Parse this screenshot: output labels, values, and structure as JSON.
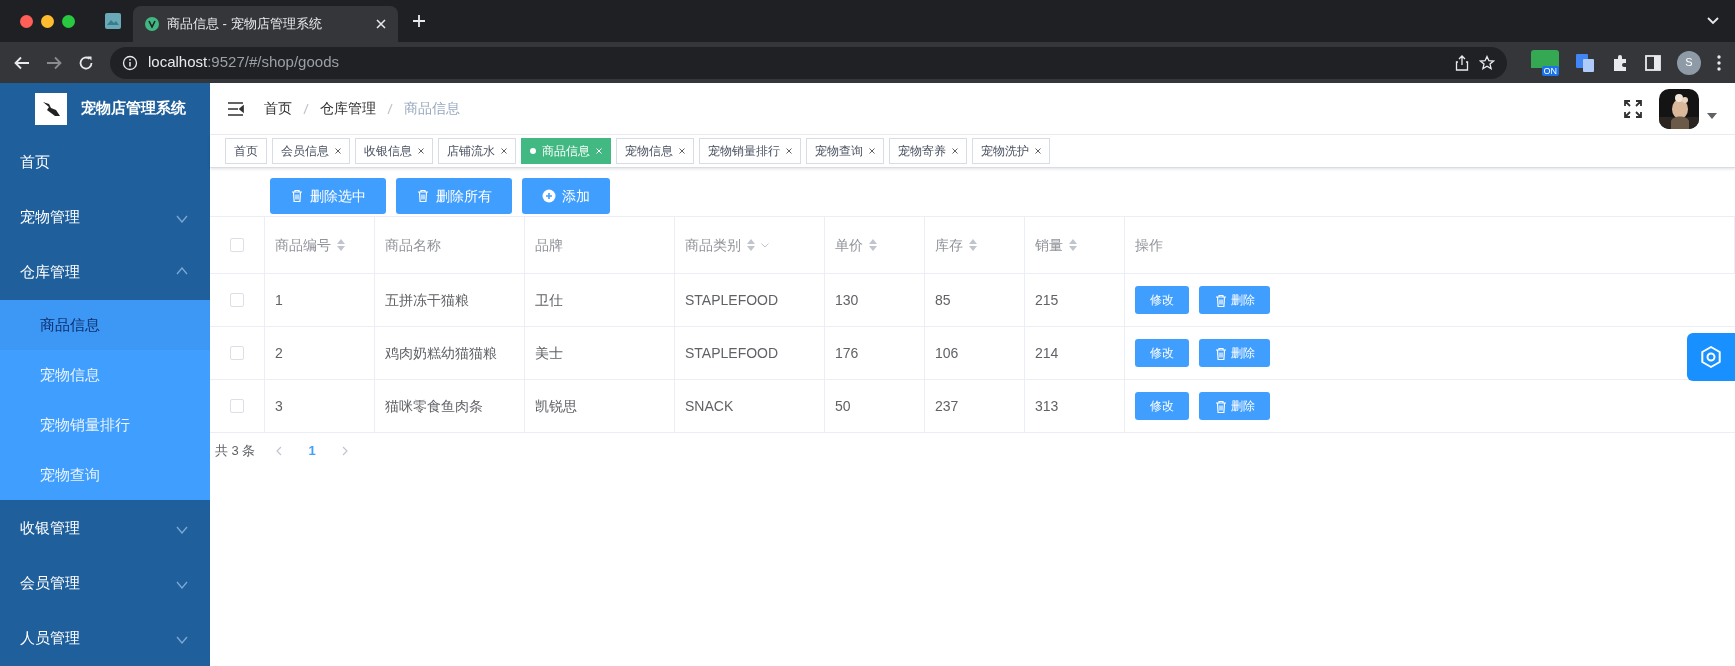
{
  "browser": {
    "tab_title": "商品信息 - 宠物店管理系统",
    "url_host": "localhost",
    "url_path": ":9527/#/shop/goods",
    "extension_badge": "ON",
    "profile_initial": "S"
  },
  "sidebar": {
    "title": "宠物店管理系统",
    "items": [
      {
        "label": "首页",
        "kind": "link",
        "selected": false
      },
      {
        "label": "宠物管理",
        "kind": "group",
        "expanded": false,
        "selected": false
      },
      {
        "label": "仓库管理",
        "kind": "group",
        "expanded": true,
        "selected": false,
        "children": [
          {
            "label": "商品信息",
            "selected": true
          },
          {
            "label": "宠物信息",
            "selected": false
          },
          {
            "label": "宠物销量排行",
            "selected": false
          },
          {
            "label": "宠物查询",
            "selected": false
          }
        ]
      },
      {
        "label": "收银管理",
        "kind": "group",
        "expanded": false,
        "selected": false
      },
      {
        "label": "会员管理",
        "kind": "group",
        "expanded": false,
        "selected": false
      },
      {
        "label": "人员管理",
        "kind": "group",
        "expanded": false,
        "selected": false
      }
    ]
  },
  "breadcrumb": [
    "首页",
    "仓库管理",
    "商品信息"
  ],
  "tags": [
    {
      "label": "首页",
      "selected": false,
      "closable": false
    },
    {
      "label": "会员信息",
      "selected": false,
      "closable": true
    },
    {
      "label": "收银信息",
      "selected": false,
      "closable": true
    },
    {
      "label": "店铺流水",
      "selected": false,
      "closable": true
    },
    {
      "label": "商品信息",
      "selected": true,
      "closable": true
    },
    {
      "label": "宠物信息",
      "selected": false,
      "closable": true
    },
    {
      "label": "宠物销量排行",
      "selected": false,
      "closable": true
    },
    {
      "label": "宠物查询",
      "selected": false,
      "closable": true
    },
    {
      "label": "宠物寄养",
      "selected": false,
      "closable": true
    },
    {
      "label": "宠物洗护",
      "selected": false,
      "closable": true
    }
  ],
  "toolbar": [
    {
      "label": "删除选中",
      "kind": "delete"
    },
    {
      "label": "删除所有",
      "kind": "delete"
    },
    {
      "label": "添加",
      "kind": "add"
    }
  ],
  "table": {
    "select_all_checked": false,
    "columns": [
      {
        "label": "商品编号",
        "sortable": true,
        "filter": false
      },
      {
        "label": "商品名称",
        "sortable": false,
        "filter": false
      },
      {
        "label": "品牌",
        "sortable": false,
        "filter": false
      },
      {
        "label": "商品类别",
        "sortable": true,
        "filter": true
      },
      {
        "label": "单价",
        "sortable": true,
        "filter": false
      },
      {
        "label": "库存",
        "sortable": true,
        "filter": false
      },
      {
        "label": "销量",
        "sortable": true,
        "filter": false
      },
      {
        "label": "操作",
        "sortable": false,
        "filter": false
      }
    ],
    "rows": [
      {
        "checked": false,
        "cells": [
          "1",
          "五拼冻干猫粮",
          "卫仕",
          "STAPLEFOOD",
          "130",
          "85",
          "215"
        ],
        "edit": "修改",
        "delete": "删除"
      },
      {
        "checked": false,
        "cells": [
          "2",
          "鸡肉奶糕幼猫猫粮",
          "美士",
          "STAPLEFOOD",
          "176",
          "106",
          "214"
        ],
        "edit": "修改",
        "delete": "删除"
      },
      {
        "checked": false,
        "cells": [
          "3",
          "猫咪零食鱼肉条",
          "凯锐思",
          "SNACK",
          "50",
          "237",
          "313"
        ],
        "edit": "修改",
        "delete": "删除"
      }
    ]
  },
  "pagination": {
    "total": "共 3 条",
    "pages": [
      {
        "label": "1",
        "selected": true
      }
    ]
  }
}
